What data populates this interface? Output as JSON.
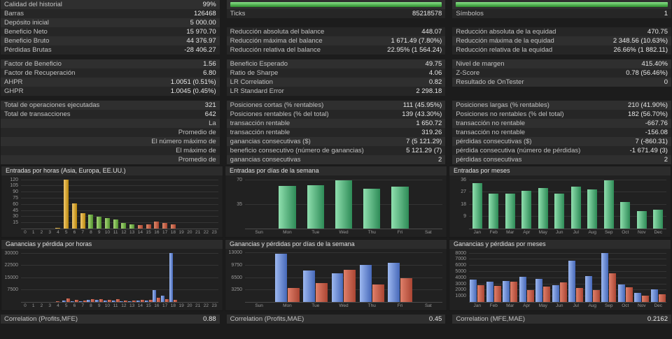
{
  "app": {
    "name": "Strategy Tester Report"
  },
  "colors": {
    "background": "#1c1c1c",
    "row_light": "#2f2f2f",
    "row_dark": "#262626",
    "palette": {
      "quality": {
        "light": "#8ae08a",
        "dark": "#2c8c2c"
      },
      "asia": {
        "light": "#f2c96d",
        "dark": "#b8860b"
      },
      "europa": {
        "light": "#a8d878",
        "dark": "#4f8f2c"
      },
      "eeuu": {
        "light": "#e08a6a",
        "dark": "#a84430"
      },
      "entry": {
        "light": "#8fdfae",
        "dark": "#2e8b57"
      },
      "profit": {
        "light": "#9db8f0",
        "dark": "#4668b8"
      },
      "loss": {
        "light": "#e0806a",
        "dark": "#aa4533"
      }
    }
  },
  "stats": {
    "rows": [
      {
        "cells": [
          {
            "label": "Calidad del historial",
            "value": "99%"
          },
          {
            "bar": true
          },
          {
            "bar": true
          }
        ]
      },
      {
        "cells": [
          {
            "label": "Barras",
            "value": "126468"
          },
          {
            "label": "Ticks",
            "value": "85218578"
          },
          {
            "label": "Símbolos",
            "value": "1"
          }
        ]
      },
      {
        "cells": [
          {
            "label": "Depósito inicial",
            "value": "5 000.00"
          },
          {},
          {}
        ]
      },
      {
        "cells": [
          {
            "label": "Beneficio Neto",
            "value": "15 970.70"
          },
          {
            "label": "Reducción absoluta del balance",
            "value": "448.07"
          },
          {
            "label": "Reducción absoluta de la equidad",
            "value": "470.75"
          }
        ]
      },
      {
        "cells": [
          {
            "label": "Beneficio Bruto",
            "value": "44 376.97"
          },
          {
            "label": "Reducción máxima del balance",
            "value": "1 671.49 (7.80%)"
          },
          {
            "label": "Reducción máxima de la equidad",
            "value": "2 348.56 (10.63%)"
          }
        ]
      },
      {
        "cells": [
          {
            "label": "Pérdidas Brutas",
            "value": "-28 406.27"
          },
          {
            "label": "Reducción relativa del balance",
            "value": "22.95% (1 564.24)"
          },
          {
            "label": "Reducción relativa de la equidad",
            "value": "26.66% (1 882.11)"
          }
        ]
      },
      {
        "gap": true
      },
      {
        "cells": [
          {
            "label": "Factor de Beneficio",
            "value": "1.56"
          },
          {
            "label": "Beneficio Esperado",
            "value": "49.75"
          },
          {
            "label": "Nivel de margen",
            "value": "415.40%"
          }
        ]
      },
      {
        "cells": [
          {
            "label": "Factor de Recuperación",
            "value": "6.80"
          },
          {
            "label": "Ratio de Sharpe",
            "value": "4.06"
          },
          {
            "label": "Z-Score",
            "value": "0.78 (56.46%)"
          }
        ]
      },
      {
        "cells": [
          {
            "label": "AHPR",
            "value": "1.0051 (0.51%)"
          },
          {
            "label": "LR Correlation",
            "value": "0.82"
          },
          {
            "label": "Resultado de OnTester",
            "value": "0"
          }
        ]
      },
      {
        "cells": [
          {
            "label": "GHPR",
            "value": "1.0045 (0.45%)"
          },
          {
            "label": "LR Standard Error",
            "value": "2 298.18"
          },
          {}
        ]
      },
      {
        "gap": true
      },
      {
        "cells": [
          {
            "label": "Total de operaciones ejecutadas",
            "value": "321"
          },
          {
            "label": "Posiciones cortas (% rentables)",
            "value": "111 (45.95%)"
          },
          {
            "label": "Posiciones largas (% rentables)",
            "value": "210 (41.90%)"
          }
        ]
      },
      {
        "cells": [
          {
            "label": "Total de transacciones",
            "value": "642"
          },
          {
            "label": "Posiciones rentables (% del total)",
            "value": "139 (43.30%)"
          },
          {
            "label": "Posiciones no rentables (% del total)",
            "value": "182 (56.70%)"
          }
        ]
      },
      {
        "cells": [
          {
            "label": "La",
            "right": true
          },
          {
            "label": "transacción rentable",
            "value": "1 650.72"
          },
          {
            "label": "transacción no rentable",
            "value": "-667.76"
          }
        ]
      },
      {
        "cells": [
          {
            "label": "Promedio de",
            "right": true
          },
          {
            "label": "transacción rentable",
            "value": "319.26"
          },
          {
            "label": "transacción no rentable",
            "value": "-156.08"
          }
        ]
      },
      {
        "cells": [
          {
            "label": "El número máximo de",
            "right": true
          },
          {
            "label": "ganancias consecutivas ($)",
            "value": "7 (5 121.29)"
          },
          {
            "label": "pérdidas consecutivas ($)",
            "value": "7 (-860.31)"
          }
        ]
      },
      {
        "cells": [
          {
            "label": "El máximo de",
            "right": true
          },
          {
            "label": "beneficio consecutivo (número de ganancias)",
            "value": "5 121.29 (7)"
          },
          {
            "label": "pérdida consecutiva (número de pérdidas)",
            "value": "-1 671.49 (3)"
          }
        ]
      },
      {
        "cells": [
          {
            "label": "Promedio de",
            "right": true
          },
          {
            "label": "ganancias consecutivas",
            "value": "2"
          },
          {
            "label": "pérdidas consecutivas",
            "value": "2"
          }
        ]
      }
    ]
  },
  "footer": {
    "items": [
      {
        "label": "Correlation (Profits,MFE)",
        "value": "0.88"
      },
      {
        "label": "Correlation (Profits,MAE)",
        "value": "0.45"
      },
      {
        "label": "Correlation (MFE,MAE)",
        "value": "0.2162"
      }
    ]
  },
  "chart_data": [
    {
      "type": "bar",
      "title": "Entradas por horas (Asia, Europa, EE.UU.)",
      "categories": [
        "0",
        "1",
        "2",
        "3",
        "4",
        "5",
        "6",
        "7",
        "8",
        "9",
        "10",
        "11",
        "12",
        "13",
        "14",
        "15",
        "16",
        "17",
        "18",
        "19",
        "20",
        "21",
        "22",
        "23"
      ],
      "values": [
        0,
        0,
        0,
        0,
        2,
        120,
        63,
        38,
        34,
        30,
        26,
        22,
        13,
        10,
        8,
        10,
        17,
        14,
        11,
        0,
        0,
        0,
        0,
        0
      ],
      "bar_palette": [
        "",
        "",
        "",
        "",
        "asia",
        "asia",
        "asia",
        "asia",
        "europa",
        "europa",
        "europa",
        "europa",
        "europa",
        "europa",
        "eeuu",
        "eeuu",
        "eeuu",
        "eeuu",
        "eeuu",
        "",
        "",
        "",
        "",
        ""
      ],
      "yticks": [
        15,
        30,
        45,
        60,
        75,
        90,
        105,
        120
      ],
      "ymax": 126
    },
    {
      "type": "bar",
      "title": "Entradas por días de la semana",
      "categories": [
        "Sun",
        "Mon",
        "Tue",
        "Wed",
        "Thu",
        "Fri",
        "Sat"
      ],
      "values": [
        0,
        62,
        63,
        70,
        58,
        61,
        0
      ],
      "color": "entry",
      "yticks": [
        35,
        70
      ],
      "ymax": 74
    },
    {
      "type": "bar",
      "title": "Entradas por meses",
      "categories": [
        "Jan",
        "Feb",
        "Mar",
        "Apr",
        "May",
        "Jun",
        "Jul",
        "Aug",
        "Sep",
        "Oct",
        "Nov",
        "Dec"
      ],
      "values": [
        34,
        26,
        26,
        28,
        30,
        26,
        31,
        29,
        36,
        20,
        13,
        14
      ],
      "color": "entry",
      "yticks": [
        9,
        18,
        27,
        36
      ],
      "ymax": 38
    },
    {
      "type": "bar",
      "title": "Ganancias y pérdida por horas",
      "categories": [
        "0",
        "1",
        "2",
        "3",
        "4",
        "5",
        "6",
        "7",
        "8",
        "9",
        "10",
        "11",
        "12",
        "13",
        "14",
        "15",
        "16",
        "17",
        "18",
        "19",
        "20",
        "21",
        "22",
        "23"
      ],
      "series": [
        {
          "name": "ganancias",
          "color": "profit",
          "values": [
            0,
            0,
            0,
            0,
            0,
            900,
            600,
            400,
            1100,
            1400,
            700,
            900,
            500,
            400,
            700,
            900,
            7200,
            4100,
            30000,
            0,
            0,
            0,
            0,
            0
          ]
        },
        {
          "name": "pérdidas",
          "color": "loss",
          "values": [
            0,
            0,
            0,
            0,
            150,
            2100,
            1400,
            900,
            1700,
            1900,
            1400,
            1700,
            900,
            700,
            1400,
            1100,
            2400,
            1900,
            1500,
            0,
            0,
            0,
            0,
            0
          ]
        }
      ],
      "yticks": [
        7500,
        15000,
        22500,
        30000
      ],
      "ymax": 31500
    },
    {
      "type": "bar",
      "title": "Ganancias y pérdidas por días de la semana",
      "categories": [
        "Sun",
        "Mon",
        "Tue",
        "Wed",
        "Thu",
        "Fri",
        "Sat"
      ],
      "series": [
        {
          "name": "ganancias",
          "color": "profit",
          "values": [
            0,
            12800,
            8300,
            7700,
            9800,
            10400,
            0
          ]
        },
        {
          "name": "pérdidas",
          "color": "loss",
          "values": [
            0,
            3700,
            5000,
            8600,
            4600,
            6400,
            0
          ]
        }
      ],
      "yticks": [
        3250,
        6500,
        9750,
        13000
      ],
      "ymax": 13600
    },
    {
      "type": "bar",
      "title": "Ganancias y pérdidas por meses",
      "categories": [
        "Jan",
        "Feb",
        "Mar",
        "Apr",
        "May",
        "Jun",
        "Jul",
        "Aug",
        "Sep",
        "Oct",
        "Nov",
        "Dec"
      ],
      "series": [
        {
          "name": "ganancias",
          "color": "profit",
          "values": [
            3700,
            3300,
            3500,
            4200,
            3800,
            2800,
            6800,
            4300,
            8000,
            2900,
            1500,
            2100
          ]
        },
        {
          "name": "pérdidas",
          "color": "loss",
          "values": [
            2800,
            2600,
            3300,
            2000,
            2500,
            3200,
            2300,
            2000,
            4700,
            2400,
            1000,
            1300
          ]
        }
      ],
      "yticks": [
        1000,
        2000,
        3000,
        4000,
        5000,
        6000,
        7000,
        8000
      ],
      "ymax": 8400
    }
  ]
}
